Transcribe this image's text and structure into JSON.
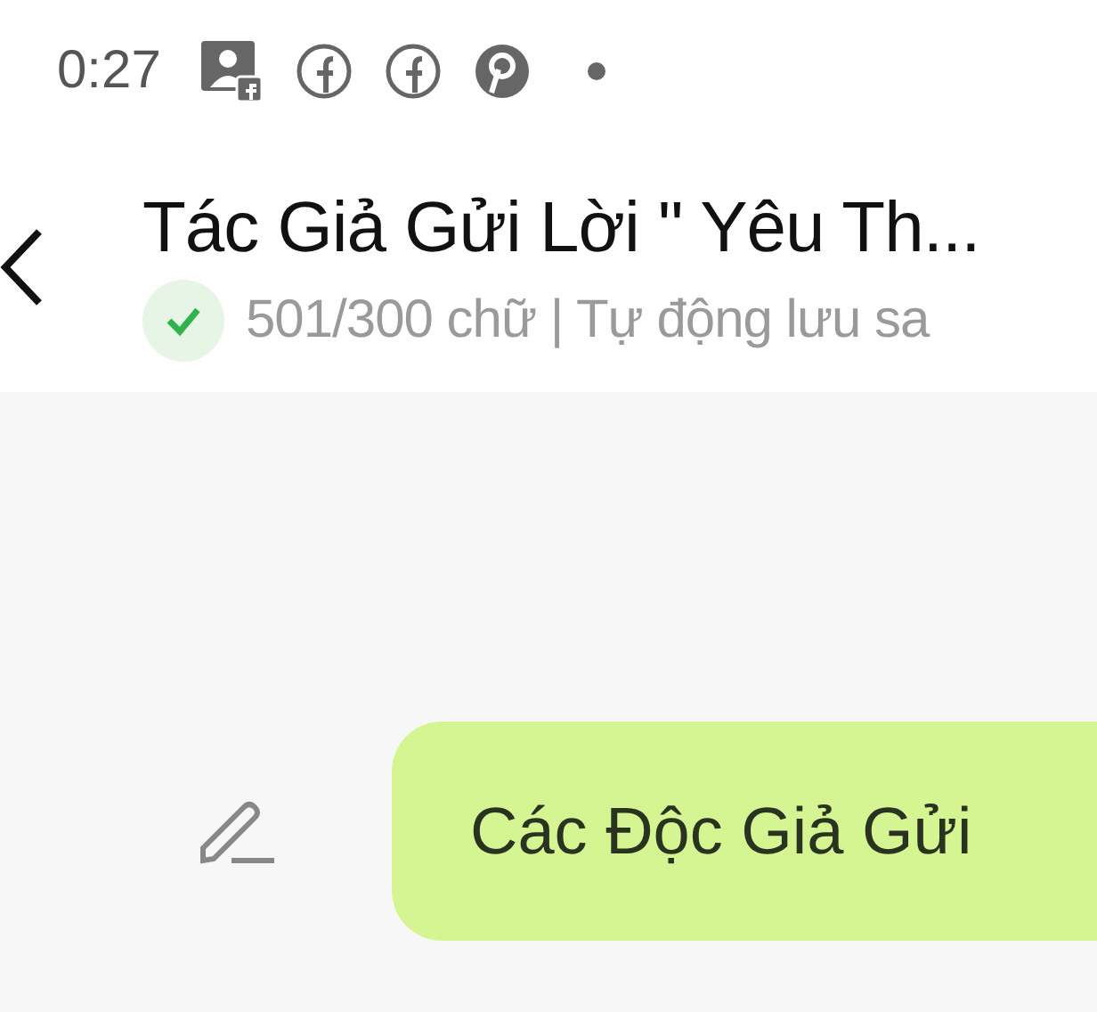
{
  "status_bar": {
    "time": "0:27"
  },
  "header": {
    "title": "Tác Giả Gửi Lời \" Yêu Th...",
    "saved": true,
    "subtitle": "501/300 chữ | Tự động lưu sa"
  },
  "message": {
    "text": "Các Độc Giả Gửi"
  }
}
